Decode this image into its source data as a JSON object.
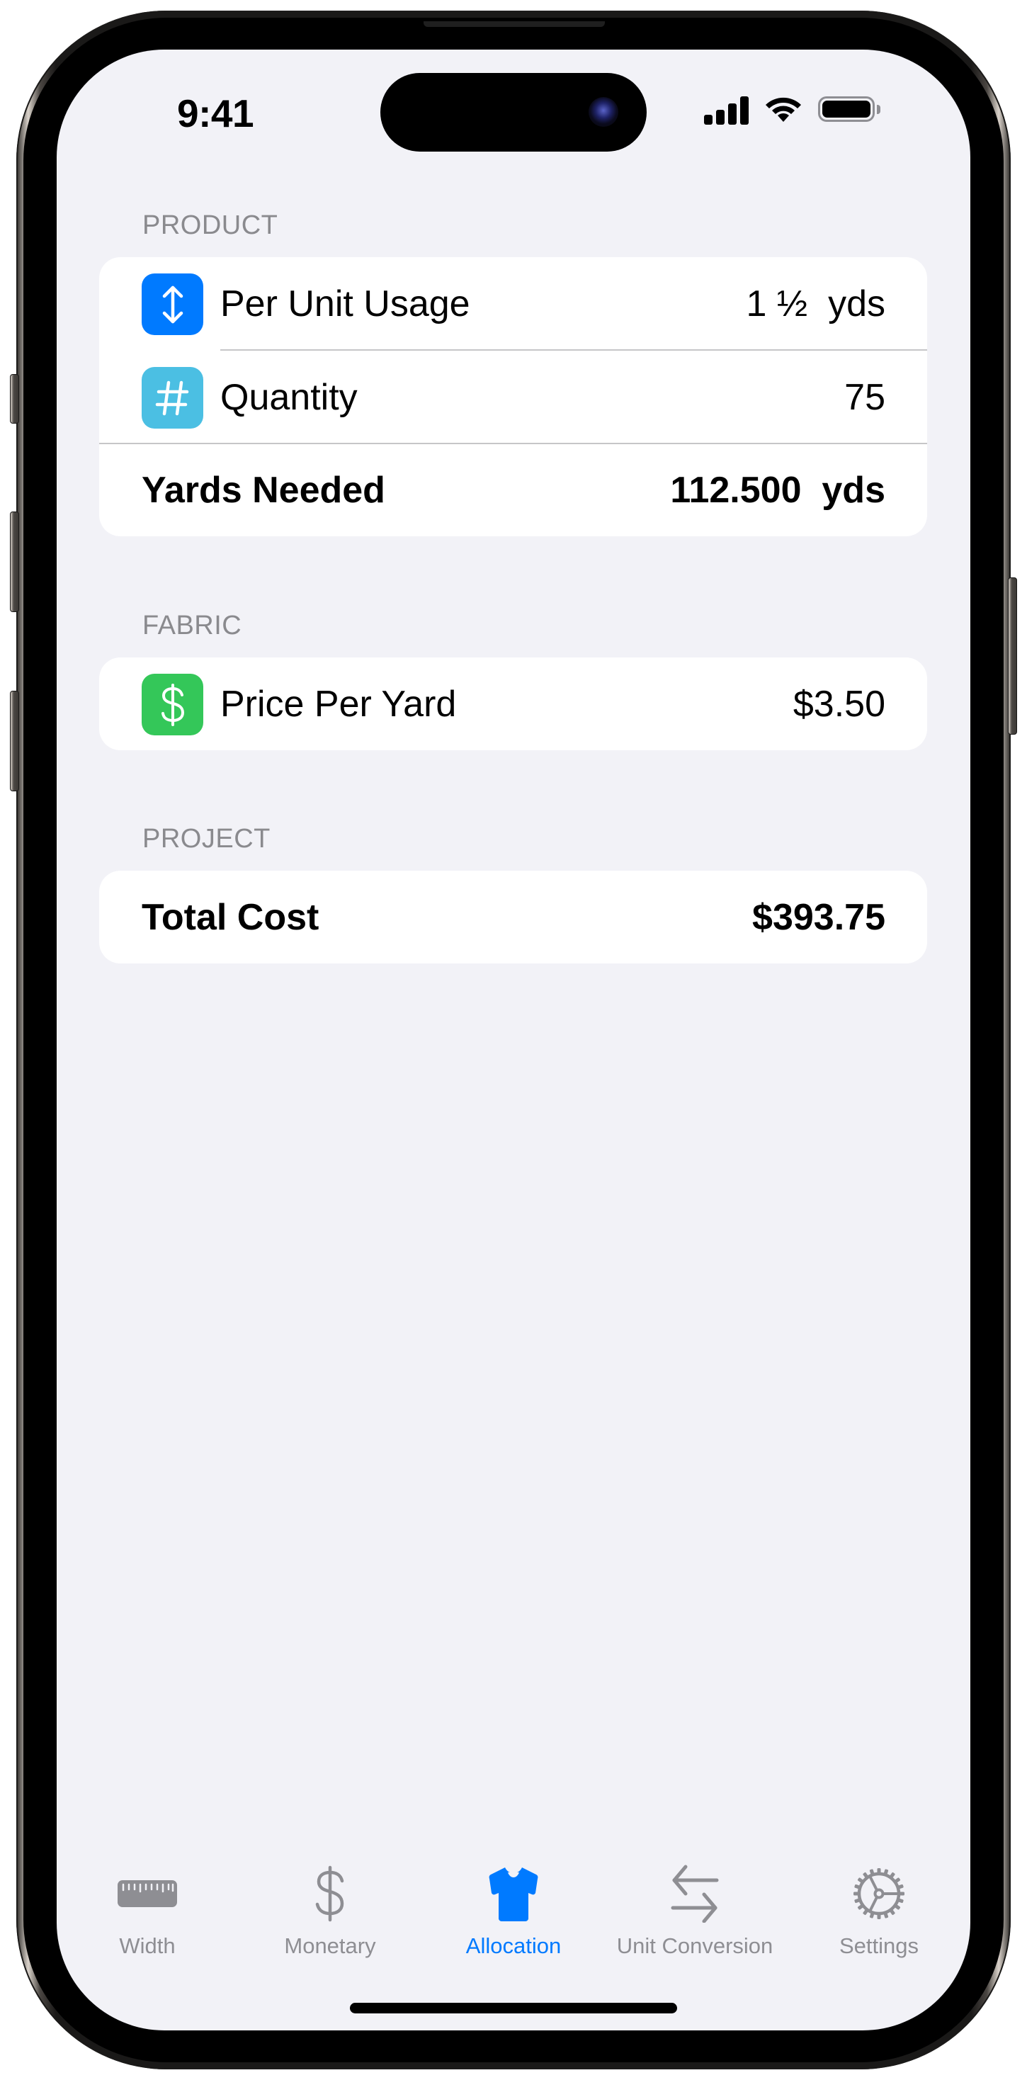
{
  "status_bar": {
    "time": "9:41",
    "icons": [
      "cellular-signal-icon",
      "wifi-icon",
      "battery-icon"
    ]
  },
  "sections": {
    "product": {
      "header": "PRODUCT",
      "rows": [
        {
          "icon": "up-down-arrow-icon",
          "icon_color": "#007aff",
          "label": "Per Unit Usage",
          "value": "1 ½  yds"
        },
        {
          "icon": "number-sign-icon",
          "icon_color": "#4bbfe3",
          "label": "Quantity",
          "value": "75"
        }
      ],
      "summary": {
        "label": "Yards Needed",
        "value": "112.500  yds"
      }
    },
    "fabric": {
      "header": "FABRIC",
      "rows": [
        {
          "icon": "dollar-sign-icon",
          "icon_color": "#34c759",
          "label": "Price Per Yard",
          "value": "$3.50"
        }
      ]
    },
    "project": {
      "header": "PROJECT",
      "summary": {
        "label": "Total Cost",
        "value": "$393.75"
      }
    }
  },
  "tab_bar": {
    "active_color": "#007aff",
    "inactive_color": "#8e8e93",
    "active_tab": "Allocation",
    "tabs": [
      {
        "label": "Width",
        "icon": "ruler-icon"
      },
      {
        "label": "Monetary",
        "icon": "dollar-sign-icon"
      },
      {
        "label": "Allocation",
        "icon": "tshirt-icon"
      },
      {
        "label": "Unit Conversion",
        "icon": "arrows-left-right-icon"
      },
      {
        "label": "Settings",
        "icon": "gear-icon"
      }
    ]
  }
}
